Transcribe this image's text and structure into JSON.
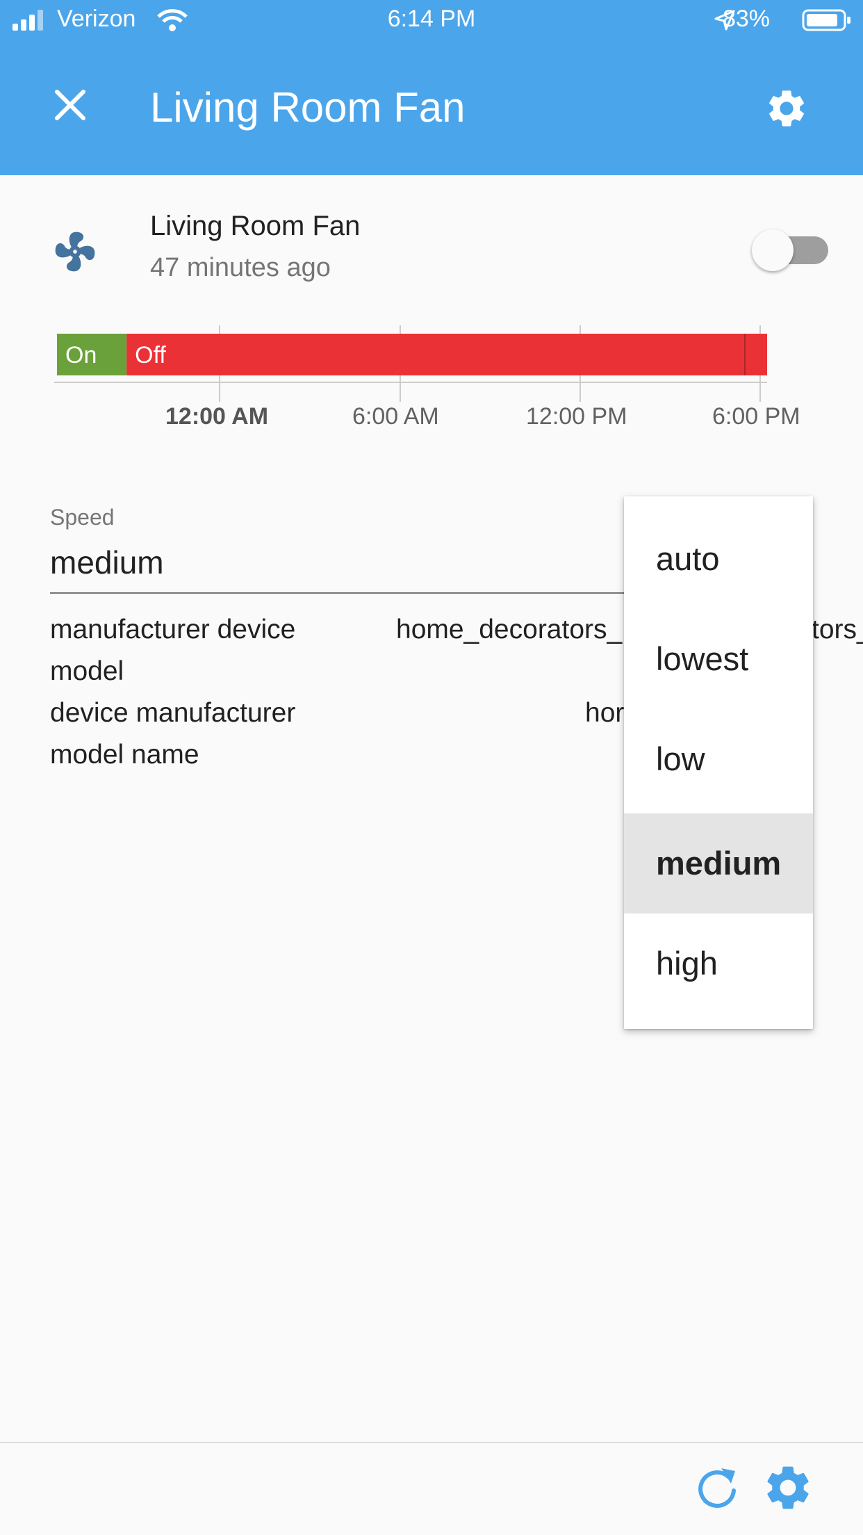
{
  "status_bar": {
    "carrier": "Verizon",
    "time": "6:14 PM",
    "battery": "83%"
  },
  "header": {
    "title": "Living Room Fan"
  },
  "entity": {
    "name": "Living Room Fan",
    "last_changed": "47 minutes ago",
    "toggle_on": false
  },
  "history": {
    "segments": [
      {
        "label": "On",
        "color": "#6aa13a",
        "start_fraction": 0.0,
        "end_fraction": 0.098
      },
      {
        "label": "Off",
        "color": "#ea3136",
        "start_fraction": 0.098,
        "end_fraction": 1.0
      }
    ],
    "axis_labels": [
      "12:00 AM",
      "6:00 AM",
      "12:00 PM",
      "6:00 PM"
    ]
  },
  "speed": {
    "label": "Speed",
    "value": "medium",
    "options": [
      "auto",
      "lowest",
      "low",
      "medium",
      "high"
    ],
    "selected": "medium"
  },
  "attributes": [
    {
      "name_line1": "manufacturer device",
      "name_line2": "model",
      "value": "home_decorators_",
      "value_tail": "tors_"
    },
    {
      "name_line1": "device manufacturer",
      "name_line2": "model name",
      "value": "hor",
      "value_tail": ""
    }
  ],
  "colors": {
    "primary": "#4ba5eb",
    "on": "#6aa13a",
    "off": "#ea3136"
  }
}
